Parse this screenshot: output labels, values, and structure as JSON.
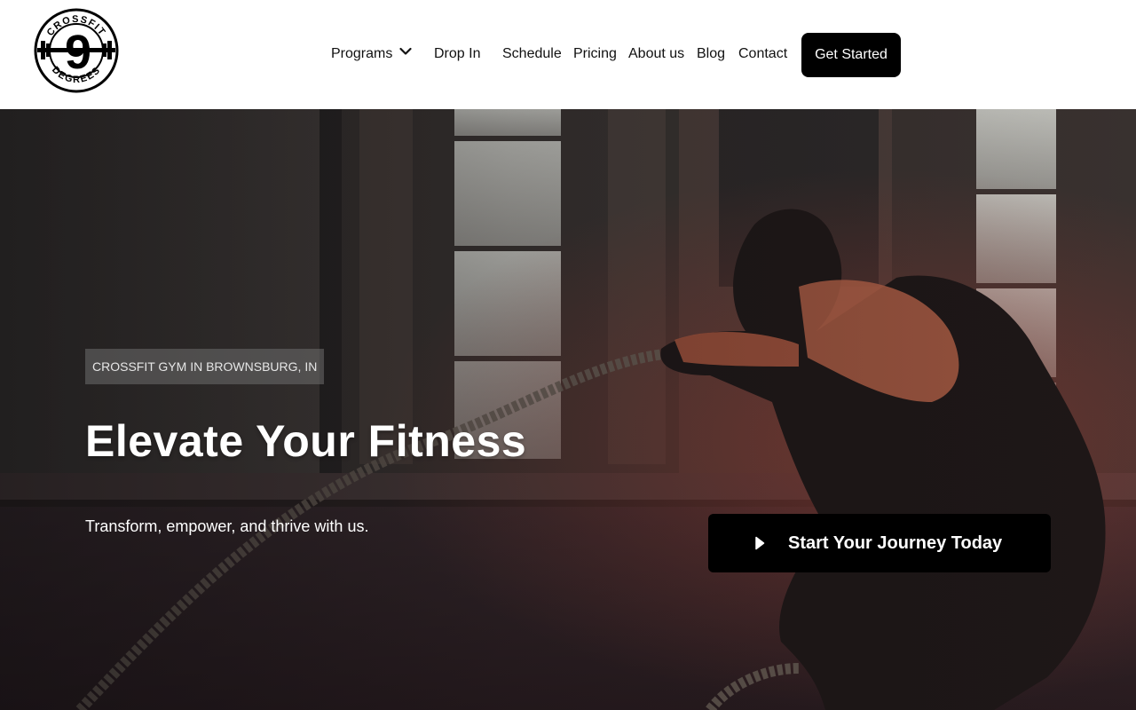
{
  "header": {
    "logo": {
      "top_text": "CROSSFIT",
      "bottom_text": "DEGREES",
      "number": "9"
    },
    "nav": [
      {
        "label": "Programs",
        "has_dropdown": true
      },
      {
        "label": "Drop In"
      },
      {
        "label": "Schedule"
      },
      {
        "label": "Pricing"
      },
      {
        "label": "About us"
      },
      {
        "label": "Blog"
      },
      {
        "label": "Contact"
      }
    ],
    "cta_label": "Get Started"
  },
  "hero": {
    "badge": "CROSSFIT GYM IN BROWNSBURG, IN",
    "title": "Elevate Your Fitness",
    "subtitle": "Transform, empower, and thrive with us.",
    "cta_label": "Start Your Journey Today",
    "cta_icon": "play-icon"
  },
  "colors": {
    "cta_background": "#000000",
    "cta_text": "#ffffff",
    "header_background": "#ffffff"
  }
}
